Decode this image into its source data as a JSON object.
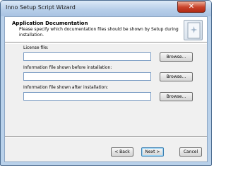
{
  "window": {
    "title": "Inno Setup Script Wizard",
    "close_glyph": "✕"
  },
  "header": {
    "title": "Application Documentation",
    "description": "Please specify which documentation files should be shown by Setup during installation.",
    "icon": "wizard-page-icon"
  },
  "fields": [
    {
      "label": "License file:",
      "value": "",
      "button_label": "Browse..."
    },
    {
      "label": "Information file shown before installation:",
      "value": "",
      "button_label": "Browse..."
    },
    {
      "label": "Information file shown after installation:",
      "value": "",
      "button_label": "Browse..."
    }
  ],
  "footer": {
    "bevel_label": "",
    "back_label": "< Back",
    "next_label": "Next >",
    "cancel_label": "Cancel"
  }
}
